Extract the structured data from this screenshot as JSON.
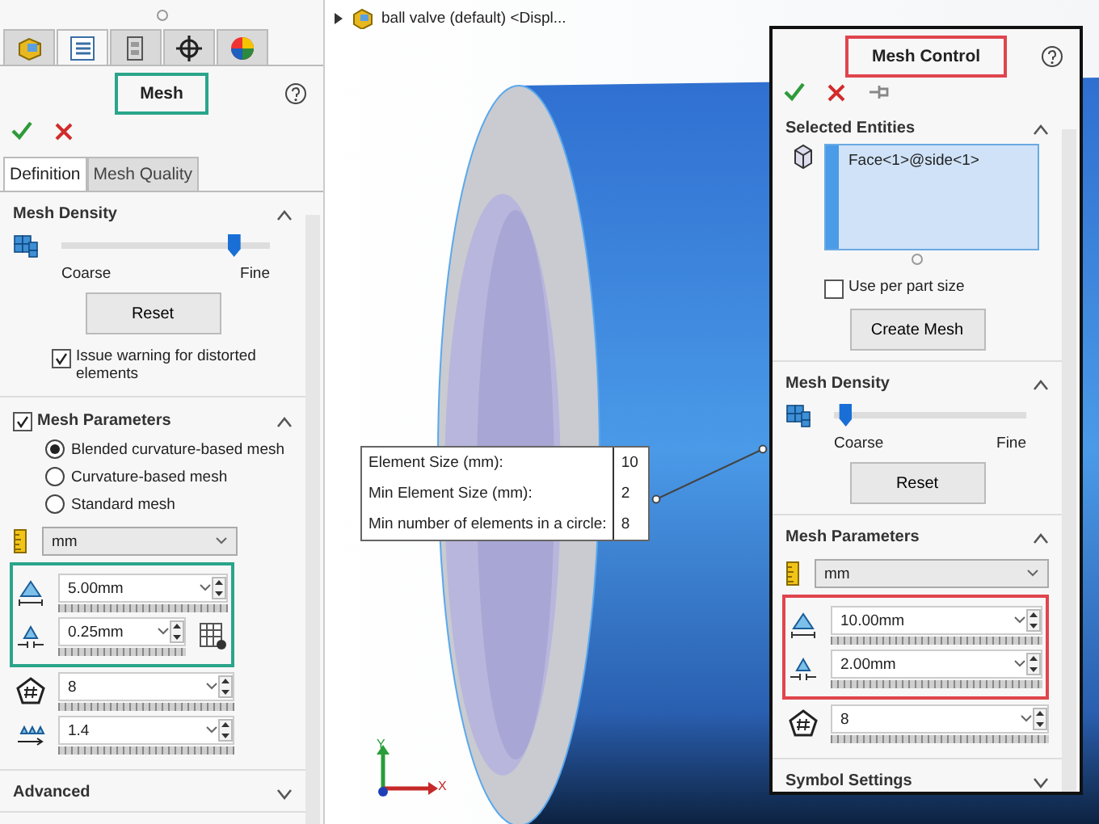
{
  "mesh_panel": {
    "tabs": [
      {
        "kind": "part",
        "selected": false
      },
      {
        "kind": "list",
        "selected": true
      },
      {
        "kind": "config",
        "selected": false
      },
      {
        "kind": "target",
        "selected": false
      },
      {
        "kind": "appearance",
        "selected": false
      }
    ],
    "title": "Mesh",
    "title_highlighted": true,
    "actions": [
      {
        "kind": "ok"
      },
      {
        "kind": "cancel"
      }
    ],
    "subtabs": [
      {
        "label": "Definition",
        "selected": true
      },
      {
        "label": "Mesh Quality",
        "selected": false
      }
    ],
    "density": {
      "title": "Mesh Density",
      "level": 0.85,
      "min_label": "Coarse",
      "max_label": "Fine",
      "reset": "Reset"
    },
    "warning": {
      "label": "Issue warning for distorted elements",
      "checked": true
    },
    "parameters": {
      "title": "Mesh Parameters",
      "checked": true,
      "options": [
        {
          "label": "Blended curvature-based mesh",
          "selected": true
        },
        {
          "label": "Curvature-based mesh",
          "selected": false
        },
        {
          "label": "Standard mesh",
          "selected": false
        }
      ],
      "unit": "mm",
      "fields": [
        {
          "kind": "element-size",
          "value": "5.00mm",
          "highlighted": true,
          "side_button": false
        },
        {
          "kind": "min-size",
          "value": "0.25mm",
          "highlighted": true,
          "side_button": true
        },
        {
          "kind": "circle-count",
          "value": "8",
          "highlighted": false,
          "side_button": false
        },
        {
          "kind": "ratio",
          "value": "1.4",
          "highlighted": false,
          "side_button": false
        }
      ]
    },
    "next_section": "Advanced"
  },
  "viewport": {
    "breadcrumb": "ball valve (default) <Displ...",
    "callout": [
      {
        "label": "Element Size (mm):",
        "value": "10"
      },
      {
        "label": "Min Element Size (mm):",
        "value": "2"
      },
      {
        "label": "Min number of elements in a circle:",
        "value": "8"
      }
    ],
    "axis_labels": {
      "y": "Y",
      "x": "X"
    }
  },
  "mesh_control": {
    "title": "Mesh Control",
    "title_highlighted": true,
    "actions": [
      {
        "kind": "ok"
      },
      {
        "kind": "cancel"
      },
      {
        "kind": "pin"
      }
    ],
    "entities": {
      "title": "Selected Entities",
      "items": [
        "Face<1>@side<1>"
      ],
      "per_part": {
        "label": "Use per part size",
        "checked": false
      },
      "button": "Create Mesh"
    },
    "density": {
      "title": "Mesh Density",
      "level": 0.03,
      "min_label": "Coarse",
      "max_label": "Fine",
      "reset": "Reset"
    },
    "parameters": {
      "title": "Mesh Parameters",
      "unit": "mm",
      "fields": [
        {
          "kind": "element-size",
          "value": "10.00mm",
          "highlighted": true
        },
        {
          "kind": "min-size",
          "value": "2.00mm",
          "highlighted": true
        },
        {
          "kind": "circle-count",
          "value": "8",
          "highlighted": false
        }
      ]
    },
    "next_section": "Symbol Settings"
  }
}
